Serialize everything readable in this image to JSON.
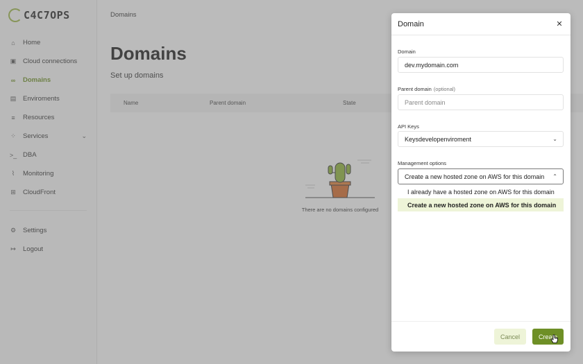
{
  "brand": {
    "logo_text": "C4C7OPS"
  },
  "sidebar": {
    "items": [
      {
        "label": "Home",
        "icon": "home-icon"
      },
      {
        "label": "Cloud connections",
        "icon": "cloud-icon"
      },
      {
        "label": "Domains",
        "icon": "link-icon",
        "active": true
      },
      {
        "label": "Enviroments",
        "icon": "layers-icon"
      },
      {
        "label": "Resources",
        "icon": "database-icon"
      },
      {
        "label": "Services",
        "icon": "services-icon",
        "expandable": true
      },
      {
        "label": "DBA",
        "icon": "terminal-icon"
      },
      {
        "label": "Monitoring",
        "icon": "chart-icon"
      },
      {
        "label": "CloudFront",
        "icon": "grid-icon"
      }
    ],
    "bottom_items": [
      {
        "label": "Settings",
        "icon": "gear-icon"
      },
      {
        "label": "Logout",
        "icon": "logout-icon"
      }
    ]
  },
  "topbar": {
    "breadcrumb": "Domains"
  },
  "page": {
    "title": "Domains",
    "subtitle": "Set up domains",
    "table": {
      "columns": [
        "Name",
        "Parent domain",
        "State"
      ]
    },
    "empty_message": "There are no domains configured"
  },
  "modal": {
    "title": "Domain",
    "domain": {
      "label": "Domain",
      "value": "dev.mydomain.com"
    },
    "parent_domain": {
      "label": "Parent domain",
      "optional": "(optional)",
      "placeholder": "Parent domain"
    },
    "api_keys": {
      "label": "API Keys",
      "value": "Keysdevelopenviroment"
    },
    "management": {
      "label": "Management options",
      "value": "Create a new hosted zone on AWS for this domain",
      "options": [
        "I already have a hosted zone on AWS for this domain",
        "Create a new hosted zone on AWS for this domain"
      ],
      "selected_index": 1
    },
    "cancel_label": "Cancel",
    "create_label": "Create"
  },
  "colors": {
    "accent": "#6e8f26",
    "accent_light": "#eef4d8",
    "overlay": "#8f8f8f"
  }
}
